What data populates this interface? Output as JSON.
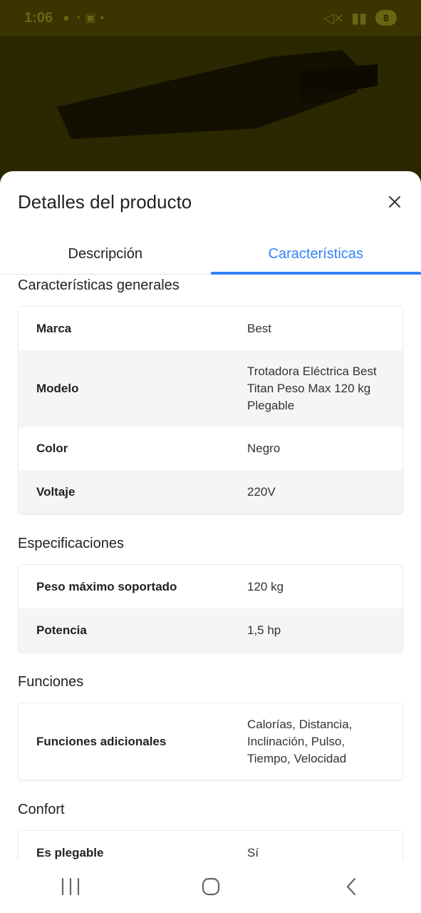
{
  "status_bar": {
    "time": "1:06",
    "icons": [
      "notification-icon",
      "dnd-icon",
      "gallery-icon",
      "dot-icon"
    ],
    "battery": "8"
  },
  "sheet": {
    "title": "Detalles del producto",
    "tabs": [
      {
        "label": "Descripción",
        "active": false
      },
      {
        "label": "Características",
        "active": true
      }
    ]
  },
  "sections": [
    {
      "title": "Características generales",
      "rows": [
        {
          "key": "Marca",
          "value": "Best"
        },
        {
          "key": "Modelo",
          "value": "Trotadora Eléctrica Best Titan Peso Max 120 kg Plegable"
        },
        {
          "key": "Color",
          "value": "Negro"
        },
        {
          "key": "Voltaje",
          "value": "220V"
        }
      ]
    },
    {
      "title": "Especificaciones",
      "rows": [
        {
          "key": "Peso máximo soportado",
          "value": "120 kg"
        },
        {
          "key": "Potencia",
          "value": "1,5 hp"
        }
      ]
    },
    {
      "title": "Funciones",
      "rows": [
        {
          "key": "Funciones adicionales",
          "value": "Calorías, Distancia, Inclinación, Pulso, Tiempo, Velocidad"
        }
      ]
    },
    {
      "title": "Confort",
      "rows": [
        {
          "key": "Es plegable",
          "value": "Sí"
        }
      ]
    }
  ],
  "colors": {
    "accent": "#3483fa",
    "text": "#222222",
    "stripe": "#f5f5f5"
  }
}
